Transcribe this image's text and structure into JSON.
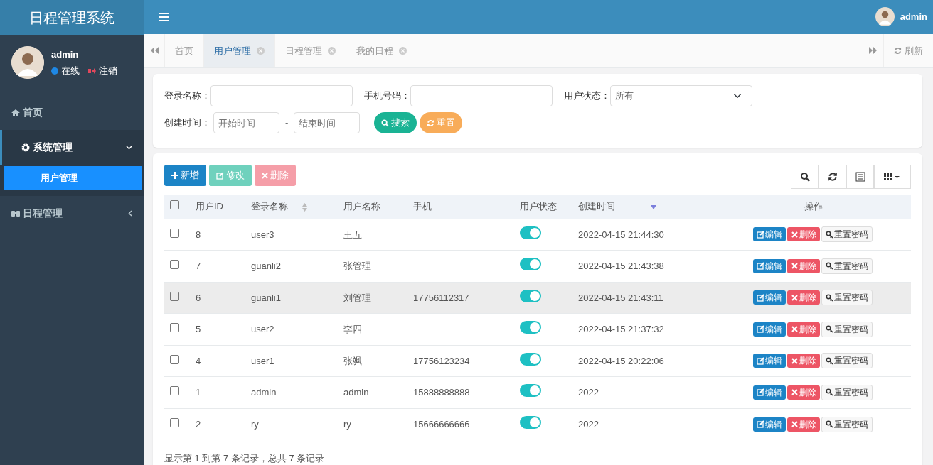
{
  "app_title": "日程管理系统",
  "user": {
    "name": "admin",
    "status": "在线",
    "logout": "注销"
  },
  "sidebar": {
    "items": [
      {
        "label": "首页",
        "selected": false
      },
      {
        "label": "系统管理",
        "expanded": true,
        "selected": false,
        "children": [
          {
            "label": "用户管理",
            "selected": true
          }
        ]
      },
      {
        "label": "日程管理",
        "expanded": false,
        "selected": false
      }
    ]
  },
  "header": {
    "user_name": "admin"
  },
  "tabs": [
    {
      "label": "首页",
      "closable": false,
      "selected": false
    },
    {
      "label": "用户管理",
      "closable": true,
      "selected": true
    },
    {
      "label": "日程管理",
      "closable": true,
      "selected": false
    },
    {
      "label": "我的日程",
      "closable": true,
      "selected": false
    }
  ],
  "refresh_label": "刷新",
  "search": {
    "login_label": "登录名称：",
    "phone_label": "手机号码：",
    "status_label": "用户状态：",
    "status_value": "所有",
    "time_label": "创建时间：",
    "start_placeholder": "开始时间",
    "dash": "-",
    "end_placeholder": "结束时间",
    "search_button": "搜索",
    "reset_button": "重置"
  },
  "toolbar": {
    "add": "新增",
    "edit": "修改",
    "delete": "删除"
  },
  "table": {
    "select_all_checked": false,
    "columns": [
      "用户ID",
      "登录名称",
      "用户名称",
      "手机",
      "用户状态",
      "创建时间",
      "操作"
    ],
    "rows": [
      {
        "id": "8",
        "login": "user3",
        "name": "王五",
        "phone": "",
        "enabled": true,
        "created": "2022-04-15 21:44:30",
        "hovered": false,
        "checked": false,
        "actions": [
          "编辑",
          "删除",
          "重置密码"
        ]
      },
      {
        "id": "7",
        "login": "guanli2",
        "name": "张管理",
        "phone": "",
        "enabled": true,
        "created": "2022-04-15 21:43:38",
        "hovered": false,
        "checked": false,
        "actions": [
          "编辑",
          "删除",
          "重置密码"
        ]
      },
      {
        "id": "6",
        "login": "guanli1",
        "name": "刘管理",
        "phone": "17756112317",
        "enabled": true,
        "created": "2022-04-15 21:43:11",
        "hovered": true,
        "checked": false,
        "actions": [
          "编辑",
          "删除",
          "重置密码"
        ]
      },
      {
        "id": "5",
        "login": "user2",
        "name": "李四",
        "phone": "",
        "enabled": true,
        "created": "2022-04-15 21:37:32",
        "hovered": false,
        "checked": false,
        "actions": [
          "编辑",
          "删除",
          "重置密码"
        ]
      },
      {
        "id": "4",
        "login": "user1",
        "name": "张飒",
        "phone": "17756123234",
        "enabled": true,
        "created": "2022-04-15 20:22:06",
        "hovered": false,
        "checked": false,
        "actions": [
          "编辑",
          "删除",
          "重置密码"
        ]
      },
      {
        "id": "1",
        "login": "admin",
        "name": "admin",
        "phone": "15888888888",
        "enabled": true,
        "created": "2022",
        "hovered": false,
        "checked": false,
        "actions": [
          "编辑",
          "删除",
          "重置密码"
        ]
      },
      {
        "id": "2",
        "login": "ry",
        "name": "ry",
        "phone": "15666666666",
        "enabled": true,
        "created": "2022",
        "hovered": false,
        "checked": false,
        "actions": [
          "编辑",
          "删除",
          "重置密码"
        ]
      }
    ]
  },
  "footer": "显示第 1 到第 7 条记录，总共 7 条记录"
}
